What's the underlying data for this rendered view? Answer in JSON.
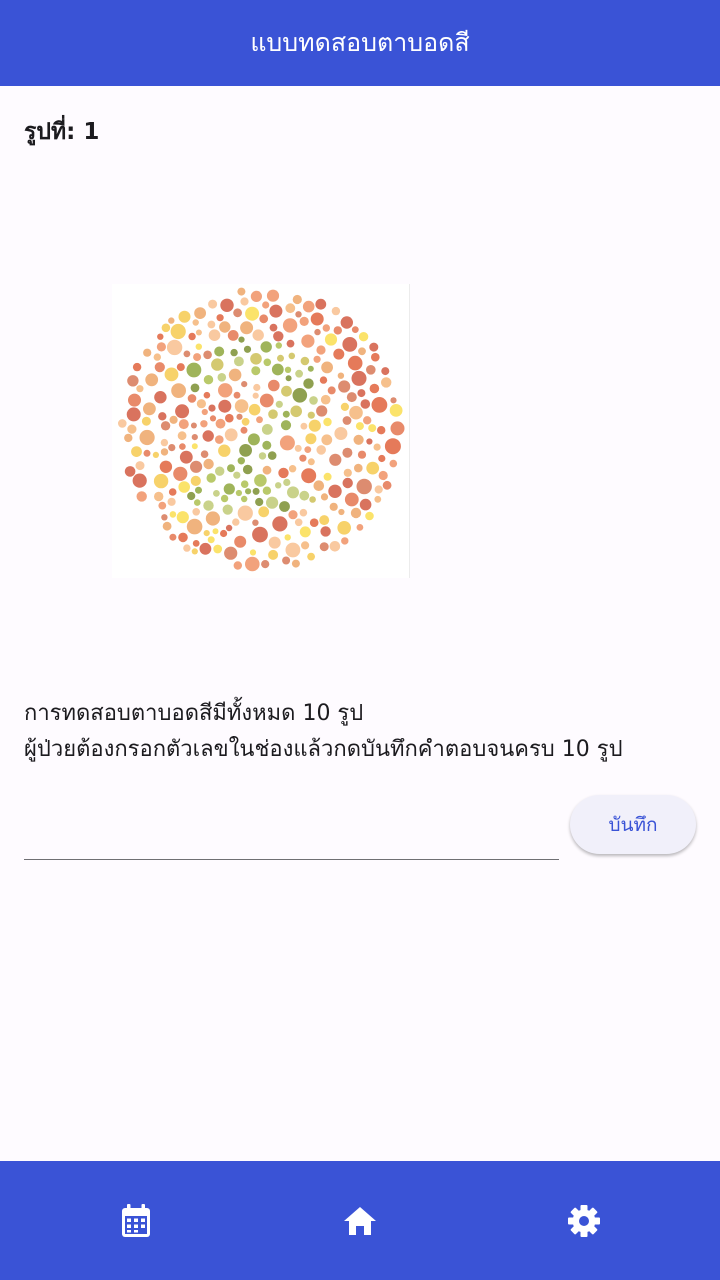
{
  "app_bar": {
    "title": "แบบทดสอบตาบอดสี"
  },
  "test": {
    "image_label": "รูปที่: 1",
    "plate_image": "ishihara-color-plate",
    "instruction_line1": "การทดสอบตาบอดสีมีทั้งหมด 10 รูป",
    "instruction_line2": "ผู้ป่วยต้องกรอกตัวเลขในช่องแล้วกดบันทึกคำตอบจนครบ 10 รูป",
    "answer_value": "",
    "answer_placeholder": "",
    "save_label": "บันทึก"
  },
  "bottom_nav": {
    "items": [
      {
        "icon": "calendar-icon"
      },
      {
        "icon": "home-icon"
      },
      {
        "icon": "gear-icon"
      }
    ]
  },
  "colors": {
    "primary": "#3a53d6",
    "background": "#fefbff",
    "button_background": "#f1f0fa"
  }
}
